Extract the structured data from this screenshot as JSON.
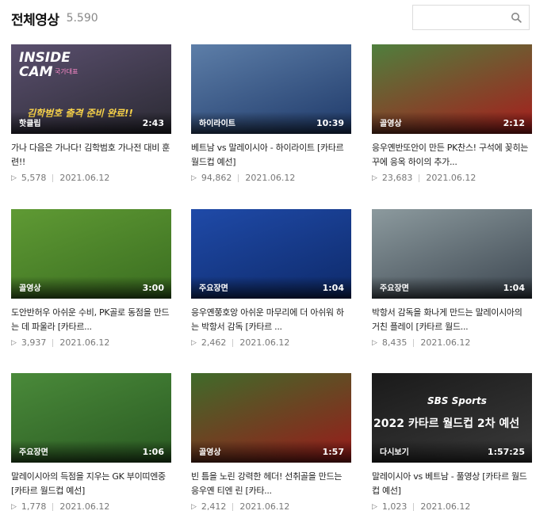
{
  "header": {
    "title": "전체영상",
    "count": "5.590"
  },
  "search": {
    "placeholder": "",
    "icon": "search-icon"
  },
  "videos": [
    {
      "badge": "핫클립",
      "duration": "2:43",
      "title": "가나 다음은 가나다! 김학범호 가나전 대비 훈련!!",
      "views": "5,578",
      "date": "2021.06.12",
      "thumb_text": "INSIDE CAM",
      "thumb_caption": "김학범호 출격 준비 완료!!",
      "thumb_sub": "국가대표",
      "colors": [
        "#5a4f6e",
        "#2b2a33"
      ]
    },
    {
      "badge": "하이라이트",
      "duration": "10:39",
      "title": "베트남 vs 말레이시아 - 하이라이트 [카타르 월드컵 예선]",
      "views": "94,862",
      "date": "2021.06.12",
      "colors": [
        "#5d7ea8",
        "#1f3a6a"
      ]
    },
    {
      "badge": "골영상",
      "duration": "2:12",
      "title": "응우옌반또안이 만든 PK찬스! 구석에 꽂히는 꾸에 응옥 하이의 추가...",
      "views": "23,683",
      "date": "2021.06.12",
      "colors": [
        "#4f7f3d",
        "#a81c1c"
      ]
    },
    {
      "badge": "골영상",
      "duration": "3:00",
      "title": "도안반허우 아쉬운 수비, PK골로 동점을 만드는 데 파울라 [카타르...",
      "views": "3,937",
      "date": "2021.06.12",
      "colors": [
        "#5f9a34",
        "#3a6d20"
      ]
    },
    {
      "badge": "주요장면",
      "duration": "1:04",
      "title": "응우옌쭝호앙 아쉬운 마무리에 더 아쉬워 하는 박항서 감독 [카타르 ...",
      "views": "2,462",
      "date": "2021.06.12",
      "colors": [
        "#1f4aa8",
        "#0e2a6a"
      ]
    },
    {
      "badge": "주요장면",
      "duration": "1:04",
      "title": "박항서 감독을 화나게 만드는 말레이시아의 거친 플레이 [카타르 월드...",
      "views": "8,435",
      "date": "2021.06.12",
      "colors": [
        "#8c9a9e",
        "#3c4650"
      ]
    },
    {
      "badge": "주요장면",
      "duration": "1:06",
      "title": "말레이시아의 득점을 지우는 GK 부이띠엔중 [카타르 월드컵 예선]",
      "views": "1,778",
      "date": "2021.06.12",
      "colors": [
        "#4a8a3a",
        "#2a5a22"
      ]
    },
    {
      "badge": "골영상",
      "duration": "1:57",
      "title": "빈 틈을 노린 강력한 헤더! 선취골을 만드는 응우옌 티엔 린 [카타...",
      "views": "2,412",
      "date": "2021.06.12",
      "colors": [
        "#3f6b2a",
        "#9a1a1a"
      ]
    },
    {
      "badge": "다시보기",
      "duration": "1:57:25",
      "title": "말레이시아 vs 베트남 - 풀영상 [카타르 월드컵 예선]",
      "views": "1,023",
      "date": "2021.06.12",
      "thumb_logo": "SBS Sports",
      "thumb_caption": "2022 카타르 월드컵 2차 예선",
      "colors": [
        "#1a1a1a",
        "#3a3a3a"
      ]
    }
  ]
}
